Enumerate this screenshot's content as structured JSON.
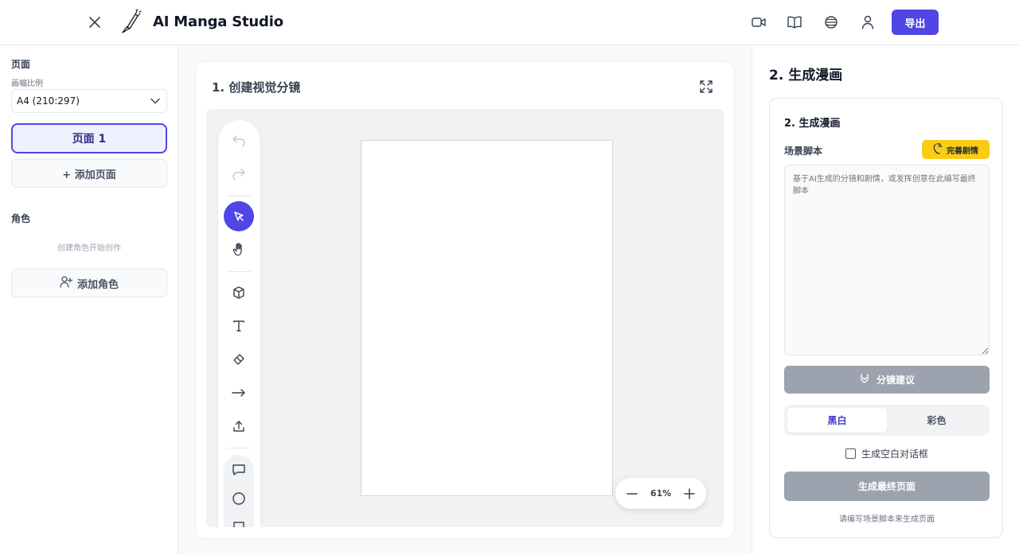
{
  "header": {
    "app_title": "AI Manga Studio",
    "icons": [
      "close-icon",
      "brush-logo-icon",
      "video-icon",
      "book-icon",
      "globe-icon",
      "user-icon"
    ],
    "export_label": "导出"
  },
  "sidebar": {
    "pages_title": "页面",
    "aspect_label": "画幅比例",
    "aspect_value": "A4 (210:297)",
    "pages": [
      "页面 1"
    ],
    "add_page_label": "+ 添加页面",
    "characters_title": "角色",
    "characters_empty_hint": "创建角色开始创作",
    "add_character_label": "添加角色"
  },
  "center": {
    "title": "1. 创建视觉分镜",
    "toolbar_tools": [
      "undo-icon",
      "redo-icon",
      "select-pointer-icon",
      "hand-pan-icon",
      "cube-icon",
      "text-icon",
      "eraser-icon",
      "arrow-right-icon",
      "upload-icon",
      "speech-bubble-icon",
      "circle-icon",
      "rectangle-icon"
    ],
    "active_tool": "select-pointer-icon",
    "zoom_value": "61%"
  },
  "right": {
    "panel_title": "2. 生成漫画",
    "card_title": "2. 生成漫画",
    "script_label": "场景脚本",
    "refine_label": "完善剧情",
    "script_placeholder": "基于AI生成的分镜和剧情，或发挥创意在此编写最终脚本",
    "storyboard_suggest_label": "分镜建议",
    "color_modes": [
      "黑白",
      "彩色"
    ],
    "selected_color_mode": "黑白",
    "blank_bubble_label": "生成空白对话框",
    "blank_bubble_checked": false,
    "generate_label": "生成最终页面",
    "footer_hint": "请编写场景脚本来生成页面"
  },
  "colors": {
    "accent": "#5046e5",
    "refine_yellow": "#facc15",
    "disabled_gray": "#9ca3af"
  }
}
